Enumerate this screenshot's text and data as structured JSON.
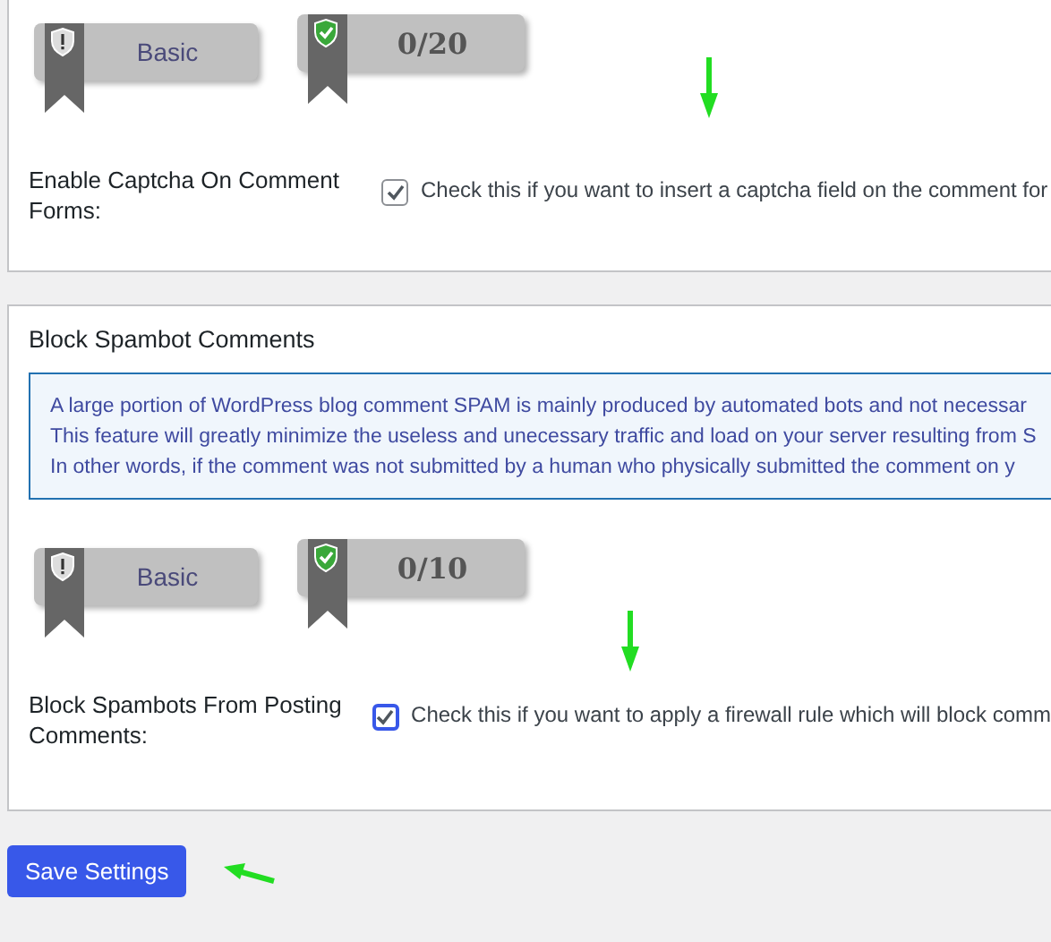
{
  "sections": [
    {
      "badges": [
        {
          "kind": "level",
          "label": "Basic"
        },
        {
          "kind": "score",
          "label": "0/20"
        }
      ],
      "option": {
        "label": "Enable Captcha On Comment Forms:",
        "checked": true,
        "focused": false,
        "description": "Check this if you want to insert a captcha field on the comment for"
      }
    },
    {
      "title": "Block Spambot Comments",
      "info": [
        "A large portion of WordPress blog comment SPAM is mainly produced by automated bots and not necessar",
        "This feature will greatly minimize the useless and unecessary traffic and load on your server resulting from S",
        "In other words, if the comment was not submitted by a human who physically submitted the comment on y"
      ],
      "badges": [
        {
          "kind": "level",
          "label": "Basic"
        },
        {
          "kind": "score",
          "label": "0/10"
        }
      ],
      "option": {
        "label": "Block Spambots From Posting Comments:",
        "checked": true,
        "focused": true,
        "description": "Check this if you want to apply a firewall rule which will block comm"
      }
    }
  ],
  "save_button": "Save Settings"
}
